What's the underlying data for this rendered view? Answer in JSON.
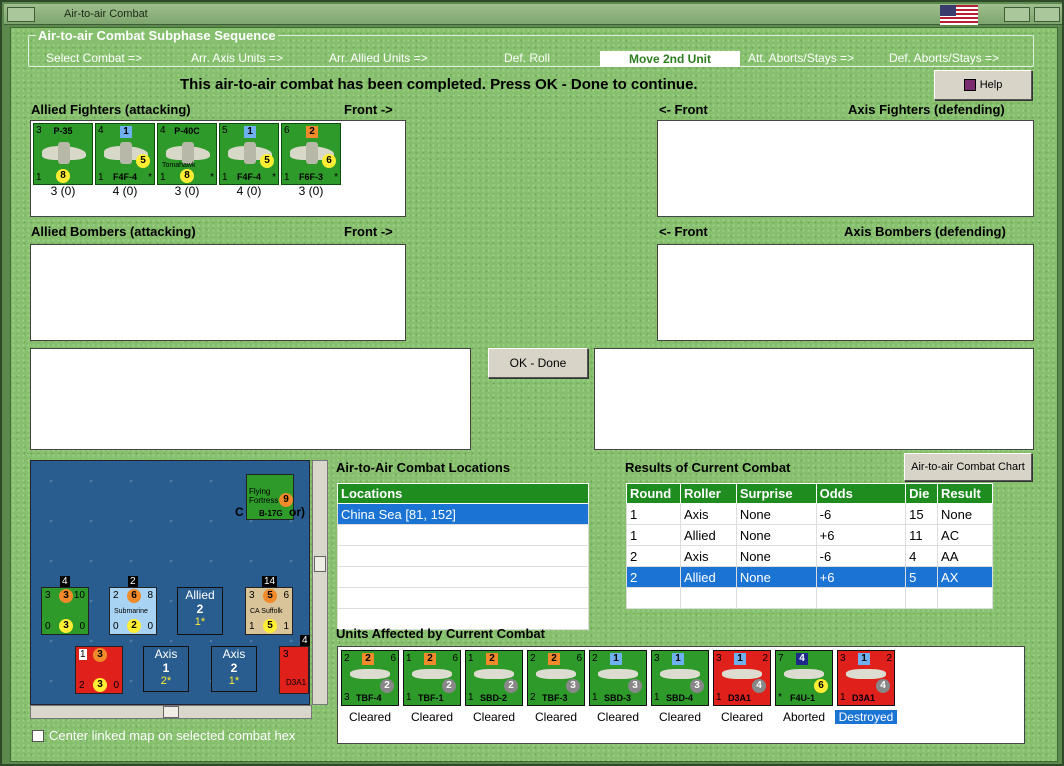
{
  "window": {
    "title": "Air-to-air Combat"
  },
  "phase": {
    "title": "Air-to-air Combat Subphase Sequence",
    "steps": [
      "Select Combat =>",
      "Arr. Axis Units =>",
      "Arr. Allied Units =>",
      "Def. Roll",
      "Move 2nd Unit",
      "Att. Aborts/Stays =>",
      "Def. Aborts/Stays =>"
    ],
    "active_step": "Move 2nd Unit"
  },
  "message": "This air-to-air combat has been completed.  Press OK - Done to continue.",
  "help_label": "Help",
  "ok_label": "OK - Done",
  "chart_label": "Air-to-air Combat Chart",
  "allied_fighters": {
    "label": "Allied Fighters (attacking)",
    "front": "Front ->",
    "units": [
      {
        "name": "P-35",
        "tl": "3",
        "tr": "",
        "bl": "1",
        "br": "",
        "badge": "8",
        "caption": "3 (0)"
      },
      {
        "name": "F4F-4",
        "tl": "4",
        "tr": "1",
        "bl": "1",
        "br": "*",
        "badge": "5",
        "caption": "4 (0)"
      },
      {
        "name": "P-40C",
        "tl": "4",
        "tr": "",
        "bl": "1",
        "br": "*",
        "badge": "8",
        "caption": "3 (0)",
        "sub": "Tomahawk"
      },
      {
        "name": "F4F-4",
        "tl": "5",
        "tr": "1",
        "bl": "1",
        "br": "*",
        "badge": "5",
        "caption": "4 (0)"
      },
      {
        "name": "F6F-3",
        "tl": "6",
        "tr": "2",
        "bl": "1",
        "br": "*",
        "badge": "6",
        "caption": "3 (0)"
      }
    ]
  },
  "axis_fighters": {
    "label": "Axis Fighters (defending)",
    "front": "<- Front"
  },
  "allied_bombers": {
    "label": "Allied Bombers (attacking)",
    "front": "Front ->"
  },
  "axis_bombers": {
    "label": "Axis Bombers (defending)",
    "front": "<- Front"
  },
  "map": {
    "top_unit": {
      "name": "B-17G",
      "sub": "Flying Fortress",
      "badge": "9",
      "label": "C",
      "label_tail": "or)"
    },
    "units": [
      {
        "top": "4",
        "a": "3",
        "b": "3",
        "c": "10",
        "d": "0",
        "e": "3",
        "f": "0"
      },
      {
        "top": "2",
        "a": "2",
        "b": "6",
        "c": "8",
        "name": "Submarine",
        "d": "0",
        "e": "2",
        "f": "0"
      },
      {
        "top": "14",
        "a": "3",
        "b": "5",
        "c": "6",
        "name": "CA Suffolk",
        "d": "1",
        "e": "5",
        "f": "1"
      },
      {
        "top": "",
        "a": "1",
        "b": "3",
        "c": "",
        "d": "2",
        "e": "3",
        "f": "0"
      },
      {
        "top": "4",
        "a": "3",
        "b": "",
        "c": "",
        "name": "D3A1"
      }
    ],
    "allied_box": {
      "side": "Allied",
      "num": "2",
      "sub": "1*"
    },
    "axis_boxes": [
      {
        "side": "Axis",
        "num": "1",
        "sub": "2*"
      },
      {
        "side": "Axis",
        "num": "2",
        "sub": "1*"
      }
    ]
  },
  "center_map_label": "Center linked map on selected combat hex",
  "locations": {
    "label": "Air-to-Air Combat Locations",
    "header": "Locations",
    "rows": [
      "China Sea [81, 152]",
      "",
      "",
      "",
      "",
      ""
    ]
  },
  "results": {
    "label": "Results of Current Combat",
    "headers": [
      "Round",
      "Roller",
      "Surprise",
      "Odds",
      "Die",
      "Result"
    ],
    "rows": [
      [
        "1",
        "Axis",
        "None",
        "-6",
        "15",
        "None"
      ],
      [
        "1",
        "Allied",
        "None",
        "+6",
        "11",
        "AC"
      ],
      [
        "2",
        "Axis",
        "None",
        "-6",
        "4",
        "AA"
      ],
      [
        "2",
        "Allied",
        "None",
        "+6",
        "5",
        "AX"
      ],
      [
        "",
        "",
        "",
        "",
        "",
        ""
      ]
    ],
    "selected_row": 3
  },
  "affected": {
    "label": "Units Affected by Current Combat",
    "units": [
      {
        "name": "TBF-4",
        "tl": "2",
        "tr": "2",
        "r": "6",
        "bl": "3",
        "badge": "2",
        "status": "Cleared",
        "color": "#2e9a2a"
      },
      {
        "name": "TBF-1",
        "tl": "1",
        "tr": "2",
        "r": "6",
        "bl": "1",
        "badge": "2",
        "status": "Cleared",
        "color": "#2e9a2a"
      },
      {
        "name": "SBD-2",
        "tl": "1",
        "tr": "2",
        "r": "",
        "bl": "1",
        "badge": "2",
        "status": "Cleared",
        "color": "#2e9a2a"
      },
      {
        "name": "TBF-3",
        "tl": "2",
        "tr": "2",
        "r": "6",
        "bl": "2",
        "badge": "3",
        "status": "Cleared",
        "color": "#2e9a2a"
      },
      {
        "name": "SBD-3",
        "tl": "2",
        "tr": "1",
        "r": "",
        "bl": "1",
        "badge": "3",
        "status": "Cleared",
        "color": "#2e9a2a"
      },
      {
        "name": "SBD-4",
        "tl": "3",
        "tr": "1",
        "r": "",
        "bl": "1",
        "badge": "3",
        "status": "Cleared",
        "color": "#2e9a2a"
      },
      {
        "name": "D3A1",
        "tl": "3",
        "tr": "1",
        "r": "2",
        "bl": "1",
        "badge": "4",
        "status": "Cleared",
        "color": "#e0201b"
      },
      {
        "name": "F4U-1",
        "tl": "7",
        "tr": "4",
        "r": "",
        "bl": "*",
        "badge": "6",
        "status": "Aborted",
        "color": "#2e9a2a"
      },
      {
        "name": "D3A1",
        "tl": "3",
        "tr": "1",
        "r": "2",
        "bl": "1",
        "badge": "4",
        "status": "Destroyed",
        "color": "#e0201b"
      }
    ]
  }
}
